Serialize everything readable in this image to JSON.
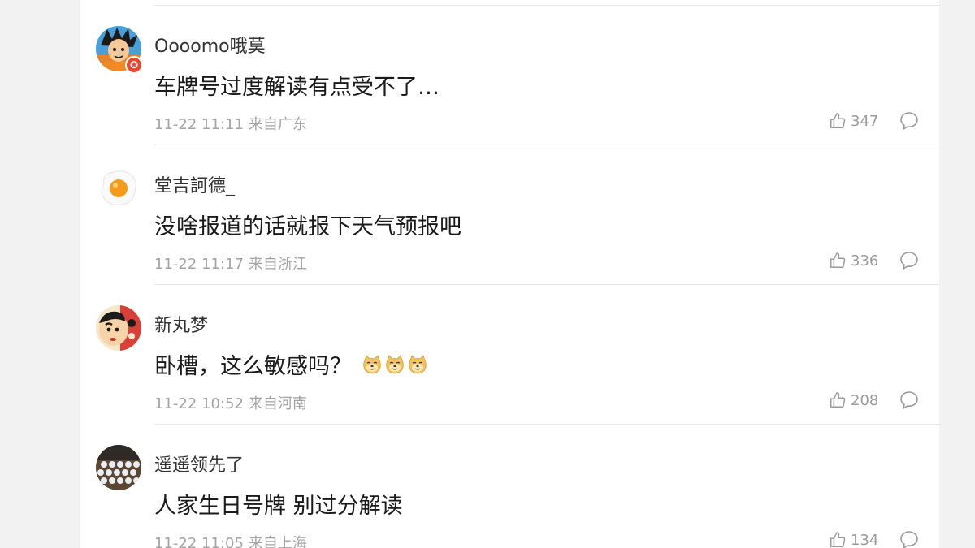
{
  "comments": [
    {
      "username": "Oooomo哦莫",
      "content": "车牌号过度解读有点受不了…",
      "time": "11-22 11:11",
      "location": "来自广东",
      "likes": "347",
      "avatar_icon": "cartoon-boy-avatar",
      "badge_icon": "star-badge-icon"
    },
    {
      "username": "堂吉訶德_",
      "content": "没啥报道的话就报下天气预报吧",
      "time": "11-22 11:17",
      "location": "来自浙江",
      "likes": "336",
      "avatar_icon": "fried-egg-avatar"
    },
    {
      "username": "新丸梦",
      "content": "卧槽，这么敏感吗？",
      "emoji_count": 3,
      "emoji_icon": "doge-emoji",
      "time": "11-22 10:52",
      "location": "来自河南",
      "likes": "208",
      "avatar_icon": "crayon-shinchan-avatar"
    },
    {
      "username": "遥遥领先了",
      "content": "人家生日号牌 别过分解读",
      "time": "11-22 11:05",
      "location": "来自上海",
      "likes": "134",
      "avatar_icon": "crowd-photo-avatar"
    }
  ],
  "colors": {
    "username": "#333333",
    "content": "#1a1a1a",
    "meta": "#a3a3a3",
    "badge": "#e8492f",
    "page_bg": "#f2f2f2",
    "panel_bg": "#ffffff"
  }
}
